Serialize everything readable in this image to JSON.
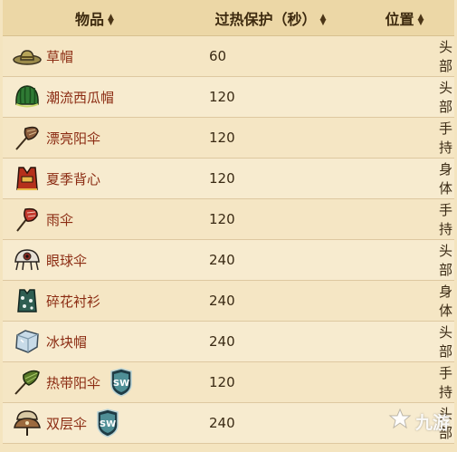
{
  "table": {
    "headers": {
      "item": "物品",
      "overheat": "过热保护（秒）",
      "slot": "位置",
      "sort_icon": "sort-arrows-icon"
    },
    "rows": [
      {
        "name": "草帽",
        "seconds": "60",
        "slot": "头部",
        "icon": "straw-hat-icon",
        "sw": false
      },
      {
        "name": "潮流西瓜帽",
        "seconds": "120",
        "slot": "头部",
        "icon": "watermelon-hat-icon",
        "sw": false
      },
      {
        "name": "漂亮阳伞",
        "seconds": "120",
        "slot": "手持",
        "icon": "pretty-parasol-icon",
        "sw": false
      },
      {
        "name": "夏季背心",
        "seconds": "120",
        "slot": "身体",
        "icon": "summer-vest-icon",
        "sw": false
      },
      {
        "name": "雨伞",
        "seconds": "120",
        "slot": "手持",
        "icon": "umbrella-icon",
        "sw": false
      },
      {
        "name": "眼球伞",
        "seconds": "240",
        "slot": "头部",
        "icon": "eyebrella-icon",
        "sw": false
      },
      {
        "name": "碎花衬衫",
        "seconds": "240",
        "slot": "身体",
        "icon": "floral-shirt-icon",
        "sw": false
      },
      {
        "name": "冰块帽",
        "seconds": "240",
        "slot": "头部",
        "icon": "ice-cube-hat-icon",
        "sw": false
      },
      {
        "name": "热带阳伞",
        "seconds": "120",
        "slot": "手持",
        "icon": "tropical-parasol-icon",
        "sw": true
      },
      {
        "name": "双层伞",
        "seconds": "240",
        "slot": "头部",
        "icon": "double-umbrella-icon",
        "sw": true
      }
    ],
    "badge": {
      "text": "SW",
      "icon": "shipwrecked-badge-icon"
    }
  },
  "watermark": {
    "text": "九游",
    "icon": "jiuyou-logo-icon"
  }
}
